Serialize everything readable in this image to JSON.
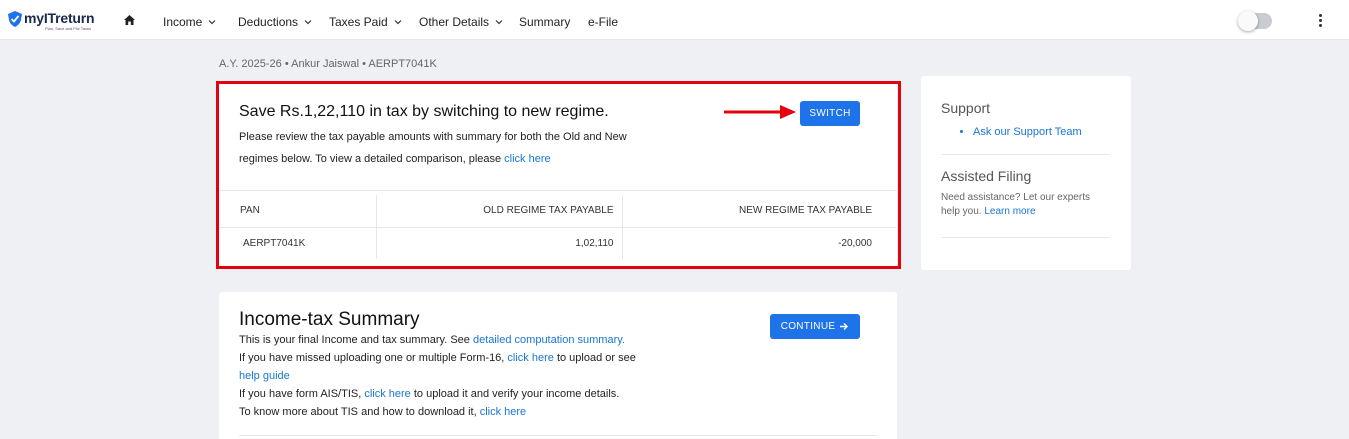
{
  "brand": {
    "name": "myITreturn",
    "tagline": "Plan, Save and File Taxes"
  },
  "nav": {
    "items": [
      {
        "label": "Income",
        "has_dropdown": true
      },
      {
        "label": "Deductions",
        "has_dropdown": true
      },
      {
        "label": "Taxes Paid",
        "has_dropdown": true
      },
      {
        "label": "Other Details",
        "has_dropdown": true
      },
      {
        "label": "Summary",
        "has_dropdown": false
      },
      {
        "label": "e-File",
        "has_dropdown": false
      }
    ],
    "theme_toggle_on": false
  },
  "assessee_line": "A.Y. 2025-26 • Ankur Jaiswal • AERPT7041K",
  "regime": {
    "title": "Save Rs.1,22,110 in tax by switching to new regime.",
    "desc_line1": "Please review the tax payable amounts with summary for both the Old and New",
    "desc_line2": "regimes below. To view a detailed comparison, please ",
    "desc_link": "click here",
    "switch_label": "SWITCH",
    "table": {
      "headers": [
        "PAN",
        "OLD REGIME TAX PAYABLE",
        "NEW REGIME TAX PAYABLE"
      ],
      "rows": [
        [
          "AERPT7041K",
          "1,02,110",
          "-20,000"
        ]
      ]
    }
  },
  "summary": {
    "title": "Income-tax Summary",
    "continue_label": "CONTINUE",
    "line1_text": "This is your final Income and tax summary. See ",
    "line1_link": "detailed computation summary.",
    "line2_text": "If you have missed uploading one or multiple Form-16, ",
    "line2_link": "click here",
    "line2_suffix": " to upload or see",
    "line3_link": "help guide",
    "line4_text": "If you have form AIS/TIS, ",
    "line4_link": "click here",
    "line4_suffix": " to upload it and verify your income details.",
    "line5_text": "To know more about TIS and how to download it, ",
    "line5_link": "click here"
  },
  "sidebar": {
    "support_title": "Support",
    "support_link": "Ask our Support Team",
    "assisted_title": "Assisted Filing",
    "assisted_text": "Need assistance? Let our experts help you. ",
    "assisted_link": "Learn more"
  },
  "colors": {
    "accent": "#1e73e8",
    "link": "#1976d2",
    "highlight_border": "#e3000f",
    "page_bg": "#eef0f4"
  },
  "icons": [
    "home-icon",
    "chevron-down-icon",
    "arrow-right-icon",
    "more-vertical-icon",
    "shield-check-icon"
  ]
}
